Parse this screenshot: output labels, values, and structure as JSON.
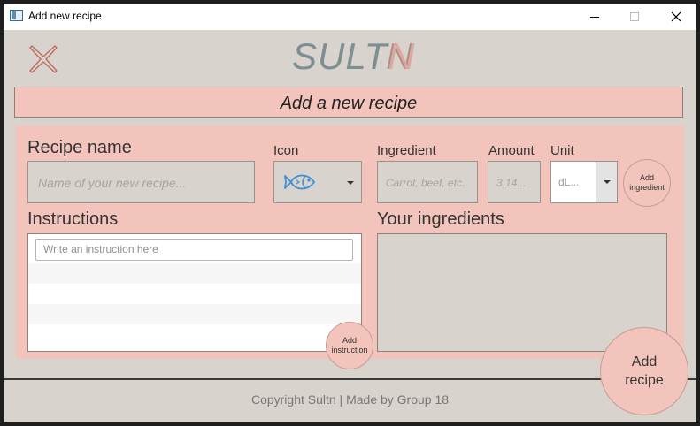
{
  "window": {
    "title": "Add new recipe"
  },
  "logo": {
    "prefix": "SULT",
    "suffix": "N"
  },
  "banner": {
    "text": "Add a new recipe"
  },
  "form": {
    "recipe_name_label": "Recipe name",
    "recipe_name_placeholder": "Name of your new recipe...",
    "icon_label": "Icon",
    "icon_value": "fish-icon",
    "ingredient_label": "Ingredient",
    "ingredient_placeholder": "Carrot, beef, etc.",
    "amount_label": "Amount",
    "amount_placeholder": "3.14...",
    "unit_label": "Unit",
    "unit_value": "dL...",
    "add_ingredient_label": "Add ingredient",
    "instructions_label": "Instructions",
    "instruction_placeholder": "Write an instruction here",
    "add_instruction_label": "Add instruction",
    "your_ingredients_label": "Your ingredients",
    "add_recipe_label": "Add recipe"
  },
  "footer": {
    "text": "Copyright Sultn | Made by Group 18"
  },
  "colors": {
    "background": "#d9d3ce",
    "accent": "#f3c4bb",
    "logo": "#7e8f92",
    "fish_icon": "#3d8fd6"
  }
}
